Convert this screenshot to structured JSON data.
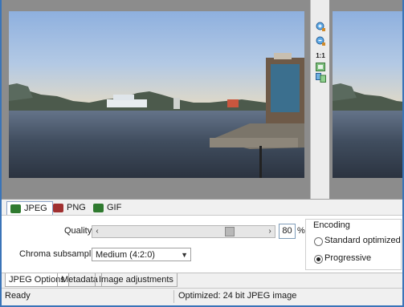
{
  "toolbar": {
    "icons": [
      "zoom-in-icon",
      "zoom-out-icon",
      "actual-size-icon",
      "fit-window-icon",
      "compare-icon"
    ],
    "actual_size_label": "1:1"
  },
  "format_tabs": [
    {
      "label": "JPEG",
      "icon": "jpeg-file-icon",
      "color": "#2f7a2f",
      "active": true
    },
    {
      "label": "PNG",
      "icon": "png-file-icon",
      "color": "#a03030",
      "active": false
    },
    {
      "label": "GIF",
      "icon": "gif-file-icon",
      "color": "#2f7a2f",
      "active": false
    }
  ],
  "options": {
    "quality_label": "Quality:",
    "quality_value": "80",
    "quality_unit": "%",
    "quality_fraction": 0.8,
    "subsampling_label": "Chroma subsampling:",
    "subsampling_value": "Medium (4:2:0)"
  },
  "encoding": {
    "title": "Encoding",
    "options": [
      "Standard optimized",
      "Progressive"
    ],
    "selected": "Progressive"
  },
  "bottom_tabs": [
    "JPEG Options",
    "Metadata",
    "Image adjustments"
  ],
  "status": {
    "left": "Ready",
    "center": "Optimized: 24 bit JPEG image"
  }
}
